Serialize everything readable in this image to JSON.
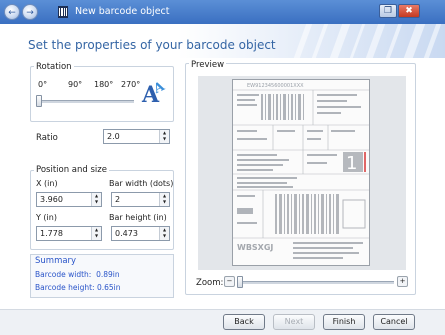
{
  "window": {
    "title": "New barcode object",
    "back_glyph": "←",
    "forward_glyph": "→",
    "restore_glyph": "❐",
    "close_glyph": "✖"
  },
  "heading": "Set the properties of your barcode object",
  "rotation": {
    "legend": "Rotation",
    "ticks": [
      "0°",
      "90°",
      "180°",
      "270°"
    ],
    "selected_index": 0,
    "preview_glyph": "A"
  },
  "ratio": {
    "label": "Ratio",
    "value": "2.0"
  },
  "position": {
    "legend": "Position and size",
    "x_label": "X (in)",
    "x_value": "3.960",
    "bar_width_label": "Bar width (dots)",
    "bar_width_value": "2",
    "y_label": "Y (in)",
    "y_value": "1.778",
    "bar_height_label": "Bar height (in)",
    "bar_height_value": "0.473"
  },
  "summary": {
    "title": "Summary",
    "barcode_width": "Barcode width:  0.89in",
    "barcode_height": "Barcode height: 0.65in"
  },
  "preview": {
    "legend": "Preview",
    "zoom_label": "Zoom:",
    "zoom_out_glyph": "−",
    "zoom_in_glyph": "+",
    "zoom_level": 0,
    "label_top_code": "EW912345600001XXX",
    "label_big_digit": "1",
    "label_bottom_code": "WBSXGJ"
  },
  "buttons": {
    "back": "Back",
    "next": "Next",
    "finish": "Finish",
    "cancel": "Cancel"
  },
  "colors": {
    "accent": "#3465a4",
    "summary_text": "#2a55c9",
    "titlebar": "#3a6fc1"
  }
}
